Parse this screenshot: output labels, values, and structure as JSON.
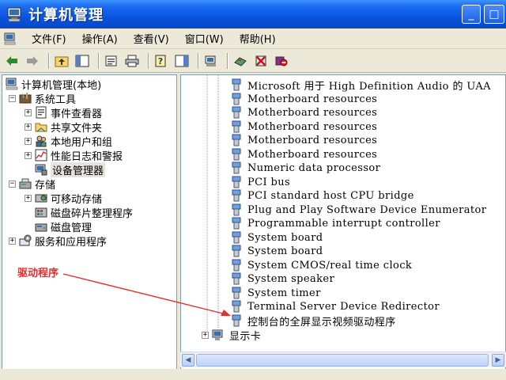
{
  "window": {
    "title": "计算机管理"
  },
  "menu": [
    "文件(F)",
    "操作(A)",
    "查看(V)",
    "窗口(W)",
    "帮助(H)"
  ],
  "tree": {
    "root": "计算机管理(本地)",
    "system_tools": "系统工具",
    "event_viewer": "事件查看器",
    "shared_folders": "共享文件夹",
    "local_users": "本地用户和组",
    "perf_logs": "性能日志和警报",
    "device_manager": "设备管理器",
    "storage": "存储",
    "removable_storage": "可移动存储",
    "defrag": "磁盘碎片整理程序",
    "disk_mgmt": "磁盘管理",
    "services_apps": "服务和应用程序"
  },
  "devices": [
    "Microsoft 用于 High Definition Audio 的 UAA",
    "Motherboard resources",
    "Motherboard resources",
    "Motherboard resources",
    "Motherboard resources",
    "Motherboard resources",
    "Numeric data processor",
    "PCI bus",
    "PCI standard host CPU bridge",
    "Plug and Play Software Device Enumerator",
    "Programmable interrupt controller",
    "System board",
    "System board",
    "System CMOS/real time clock",
    "System speaker",
    "System timer",
    "Terminal Server Device Redirector",
    "控制台的全屏显示视频驱动程序"
  ],
  "display_adapter": "显示卡",
  "annotation": {
    "text": "驱动程序",
    "color": "#e23030"
  }
}
